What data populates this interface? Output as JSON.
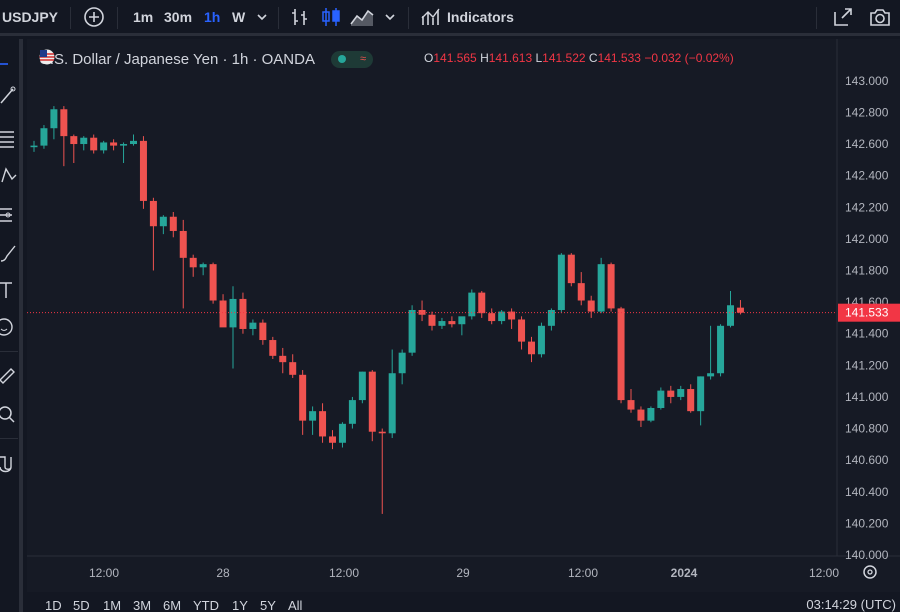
{
  "toolbar": {
    "symbol": "USDJPY",
    "intervals": [
      "1m",
      "30m",
      "1h",
      "W"
    ],
    "active_interval": "1h",
    "indicators_label": "Indicators"
  },
  "legend": {
    "title": "U.S. Dollar / Japanese Yen · 1h · OANDA",
    "open_key": "O",
    "open": "141.565",
    "high_key": "H",
    "high": "141.613",
    "low_key": "L",
    "low": "141.522",
    "close_key": "C",
    "close": "141.533",
    "change": "−0.032 (−0.02%)"
  },
  "bottom": {
    "ranges": [
      "1D",
      "5D",
      "1M",
      "3M",
      "6M",
      "YTD",
      "1Y",
      "5Y",
      "All"
    ],
    "clock": "03:14:29 (UTC)"
  },
  "colors": {
    "up": "#26a69a",
    "down": "#ef5350",
    "background": "#161a25",
    "price_label": "#f23645"
  },
  "chart_data": {
    "type": "candlestick",
    "ylim": [
      140.0,
      143.1
    ],
    "y_ticks": [
      "143.000",
      "142.800",
      "142.600",
      "142.400",
      "142.200",
      "142.000",
      "141.800",
      "141.600",
      "141.400",
      "141.200",
      "141.000",
      "140.800",
      "140.600",
      "140.400",
      "140.200",
      "140.000"
    ],
    "x_ticks": [
      "12:00",
      "28",
      "12:00",
      "29",
      "12:00",
      "2024",
      "12:00"
    ],
    "last_price": 141.533,
    "candles": [
      {
        "o": 142.58,
        "h": 142.62,
        "l": 142.55,
        "c": 142.59
      },
      {
        "o": 142.59,
        "h": 142.72,
        "l": 142.57,
        "c": 142.7
      },
      {
        "o": 142.7,
        "h": 142.84,
        "l": 142.63,
        "c": 142.82
      },
      {
        "o": 142.82,
        "h": 142.84,
        "l": 142.46,
        "c": 142.65
      },
      {
        "o": 142.65,
        "h": 142.66,
        "l": 142.48,
        "c": 142.6
      },
      {
        "o": 142.6,
        "h": 142.65,
        "l": 142.56,
        "c": 142.64
      },
      {
        "o": 142.64,
        "h": 142.66,
        "l": 142.54,
        "c": 142.56
      },
      {
        "o": 142.56,
        "h": 142.62,
        "l": 142.54,
        "c": 142.61
      },
      {
        "o": 142.61,
        "h": 142.63,
        "l": 142.56,
        "c": 142.59
      },
      {
        "o": 142.59,
        "h": 142.61,
        "l": 142.48,
        "c": 142.6
      },
      {
        "o": 142.6,
        "h": 142.66,
        "l": 142.59,
        "c": 142.62
      },
      {
        "o": 142.62,
        "h": 142.65,
        "l": 142.19,
        "c": 142.24
      },
      {
        "o": 142.24,
        "h": 142.26,
        "l": 141.8,
        "c": 142.08
      },
      {
        "o": 142.08,
        "h": 142.15,
        "l": 142.03,
        "c": 142.14
      },
      {
        "o": 142.14,
        "h": 142.17,
        "l": 142.01,
        "c": 142.05
      },
      {
        "o": 142.05,
        "h": 142.12,
        "l": 141.56,
        "c": 141.88
      },
      {
        "o": 141.88,
        "h": 141.9,
        "l": 141.76,
        "c": 141.82
      },
      {
        "o": 141.82,
        "h": 141.85,
        "l": 141.77,
        "c": 141.84
      },
      {
        "o": 141.84,
        "h": 141.85,
        "l": 141.59,
        "c": 141.61
      },
      {
        "o": 141.61,
        "h": 141.65,
        "l": 141.46,
        "c": 141.44
      },
      {
        "o": 141.44,
        "h": 141.7,
        "l": 141.18,
        "c": 141.62
      },
      {
        "o": 141.62,
        "h": 141.66,
        "l": 141.4,
        "c": 141.43
      },
      {
        "o": 141.43,
        "h": 141.49,
        "l": 141.39,
        "c": 141.47
      },
      {
        "o": 141.47,
        "h": 141.49,
        "l": 141.33,
        "c": 141.36
      },
      {
        "o": 141.36,
        "h": 141.38,
        "l": 141.24,
        "c": 141.26
      },
      {
        "o": 141.26,
        "h": 141.31,
        "l": 141.15,
        "c": 141.22
      },
      {
        "o": 141.22,
        "h": 141.27,
        "l": 141.12,
        "c": 141.14
      },
      {
        "o": 141.14,
        "h": 141.17,
        "l": 140.76,
        "c": 140.85
      },
      {
        "o": 140.85,
        "h": 140.94,
        "l": 140.76,
        "c": 140.91
      },
      {
        "o": 140.91,
        "h": 140.96,
        "l": 140.71,
        "c": 140.75
      },
      {
        "o": 140.75,
        "h": 140.79,
        "l": 140.67,
        "c": 140.71
      },
      {
        "o": 140.71,
        "h": 140.84,
        "l": 140.68,
        "c": 140.83
      },
      {
        "o": 140.83,
        "h": 141.0,
        "l": 140.8,
        "c": 140.98
      },
      {
        "o": 140.98,
        "h": 141.16,
        "l": 140.96,
        "c": 141.16
      },
      {
        "o": 141.16,
        "h": 141.17,
        "l": 140.72,
        "c": 140.78
      },
      {
        "o": 140.78,
        "h": 140.8,
        "l": 140.26,
        "c": 140.77
      },
      {
        "o": 140.77,
        "h": 141.3,
        "l": 140.74,
        "c": 141.15
      },
      {
        "o": 141.15,
        "h": 141.3,
        "l": 141.08,
        "c": 141.28
      },
      {
        "o": 141.28,
        "h": 141.58,
        "l": 141.26,
        "c": 141.55
      },
      {
        "o": 141.55,
        "h": 141.61,
        "l": 141.48,
        "c": 141.52
      },
      {
        "o": 141.52,
        "h": 141.54,
        "l": 141.42,
        "c": 141.45
      },
      {
        "o": 141.45,
        "h": 141.5,
        "l": 141.43,
        "c": 141.48
      },
      {
        "o": 141.48,
        "h": 141.51,
        "l": 141.44,
        "c": 141.46
      },
      {
        "o": 141.46,
        "h": 141.5,
        "l": 141.39,
        "c": 141.51
      },
      {
        "o": 141.51,
        "h": 141.68,
        "l": 141.49,
        "c": 141.66
      },
      {
        "o": 141.66,
        "h": 141.67,
        "l": 141.5,
        "c": 141.53
      },
      {
        "o": 141.53,
        "h": 141.56,
        "l": 141.46,
        "c": 141.48
      },
      {
        "o": 141.48,
        "h": 141.55,
        "l": 141.46,
        "c": 141.54
      },
      {
        "o": 141.54,
        "h": 141.56,
        "l": 141.43,
        "c": 141.49
      },
      {
        "o": 141.49,
        "h": 141.51,
        "l": 141.3,
        "c": 141.35
      },
      {
        "o": 141.35,
        "h": 141.38,
        "l": 141.22,
        "c": 141.27
      },
      {
        "o": 141.27,
        "h": 141.47,
        "l": 141.25,
        "c": 141.45
      },
      {
        "o": 141.45,
        "h": 141.56,
        "l": 141.42,
        "c": 141.55
      },
      {
        "o": 141.55,
        "h": 141.91,
        "l": 141.53,
        "c": 141.9
      },
      {
        "o": 141.9,
        "h": 141.91,
        "l": 141.7,
        "c": 141.72
      },
      {
        "o": 141.72,
        "h": 141.79,
        "l": 141.58,
        "c": 141.61
      },
      {
        "o": 141.61,
        "h": 141.64,
        "l": 141.5,
        "c": 141.54
      },
      {
        "o": 141.54,
        "h": 141.88,
        "l": 141.53,
        "c": 141.84
      },
      {
        "o": 141.84,
        "h": 141.85,
        "l": 141.54,
        "c": 141.56
      },
      {
        "o": 141.56,
        "h": 141.57,
        "l": 140.96,
        "c": 140.98
      },
      {
        "o": 140.98,
        "h": 141.05,
        "l": 140.9,
        "c": 140.92
      },
      {
        "o": 140.92,
        "h": 140.94,
        "l": 140.81,
        "c": 140.85
      },
      {
        "o": 140.85,
        "h": 140.94,
        "l": 140.84,
        "c": 140.93
      },
      {
        "o": 140.93,
        "h": 141.06,
        "l": 140.92,
        "c": 141.04
      },
      {
        "o": 141.04,
        "h": 141.07,
        "l": 140.96,
        "c": 141.0
      },
      {
        "o": 141.0,
        "h": 141.07,
        "l": 140.98,
        "c": 141.05
      },
      {
        "o": 141.05,
        "h": 141.08,
        "l": 140.9,
        "c": 140.91
      },
      {
        "o": 140.91,
        "h": 141.13,
        "l": 140.82,
        "c": 141.13
      },
      {
        "o": 141.13,
        "h": 141.45,
        "l": 141.11,
        "c": 141.15
      },
      {
        "o": 141.15,
        "h": 141.46,
        "l": 141.13,
        "c": 141.45
      },
      {
        "o": 141.45,
        "h": 141.67,
        "l": 141.44,
        "c": 141.58
      },
      {
        "o": 141.565,
        "h": 141.613,
        "l": 141.522,
        "c": 141.533
      }
    ]
  }
}
